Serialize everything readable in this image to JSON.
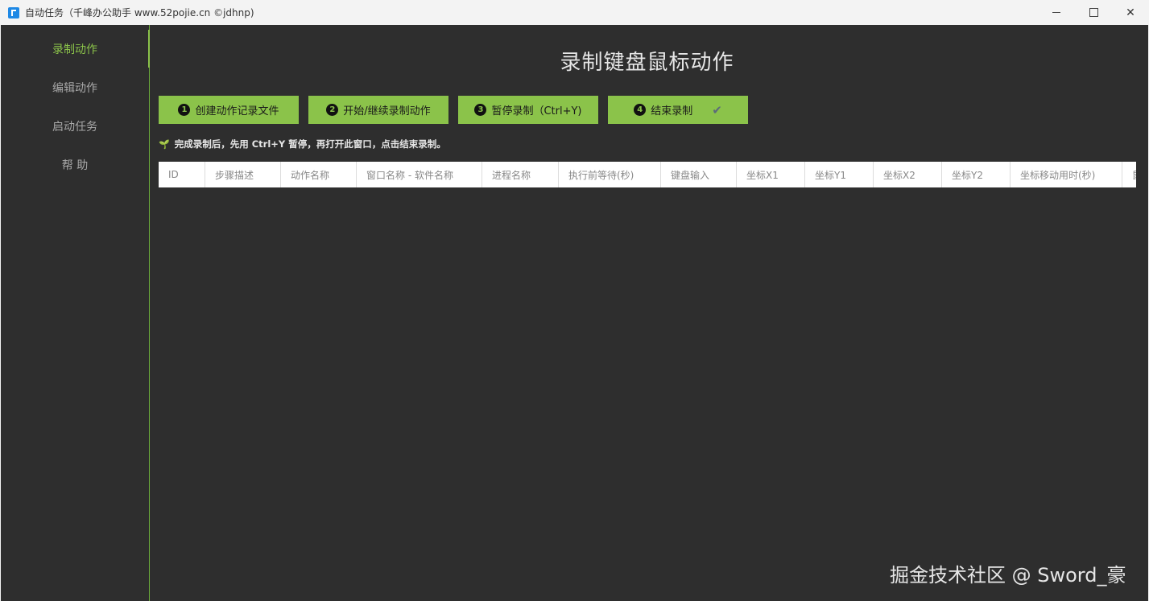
{
  "window": {
    "title": "自动任务（千峰办公助手 www.52pojie.cn ©jdhnp)"
  },
  "sidebar": {
    "items": [
      {
        "label": "录制动作",
        "active": true
      },
      {
        "label": "编辑动作",
        "active": false
      },
      {
        "label": "启动任务",
        "active": false
      },
      {
        "label": "帮 助",
        "active": false
      }
    ]
  },
  "main": {
    "title": "录制键盘鼠标动作",
    "buttons": [
      {
        "num": "1",
        "label": "创建动作记录文件"
      },
      {
        "num": "2",
        "label": "开始/继续录制动作"
      },
      {
        "num": "3",
        "label": "暂停录制（Ctrl+Y)"
      },
      {
        "num": "4",
        "label": "结束录制",
        "icon": "check-icon"
      }
    ],
    "hint": "完成录制后，先用 Ctrl+Y 暂停，再打开此窗口，点击结束录制。",
    "table": {
      "columns": [
        "ID",
        "步骤描述",
        "动作名称",
        "窗口名称 - 软件名称",
        "进程名称",
        "执行前等待(秒)",
        "键盘输入",
        "坐标X1",
        "坐标Y1",
        "坐标X2",
        "坐标Y2",
        "坐标移动用时(秒)",
        "鼠"
      ],
      "rows": []
    }
  },
  "watermark": "掘金技术社区 @ Sword_豪",
  "colors": {
    "accent": "#8bc34a",
    "background": "#2e2e2e",
    "titlebar": "#f3f3f3"
  }
}
